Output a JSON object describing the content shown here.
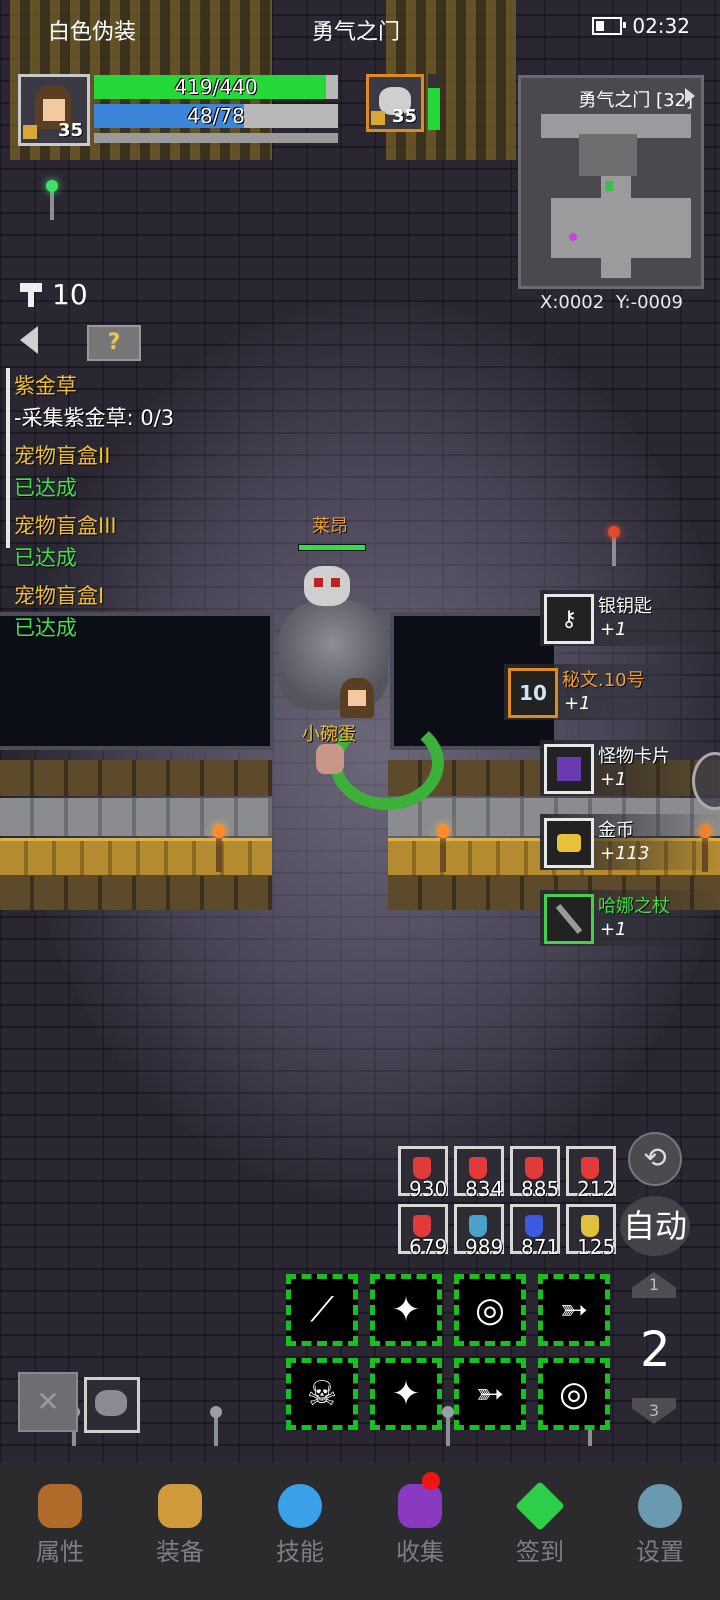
{
  "status_bar": {
    "left": "白色伪装",
    "center": "勇气之门",
    "time": "02:32"
  },
  "player": {
    "level": "35",
    "hp": "419/440",
    "hp_ratio": 0.952,
    "mp": "48/78",
    "mp_ratio": 0.615
  },
  "target": {
    "level": "35",
    "hp_ratio": 0.75
  },
  "minimap": {
    "title": "勇气之门 [32]",
    "coords": "X:0002  Y:-0009"
  },
  "resource": {
    "key_count": "10",
    "help_label": "?"
  },
  "quests": [
    {
      "title": "紫金草",
      "desc": "-采集紫金草: 0/3"
    },
    {
      "title": "宠物盲盒II",
      "desc": "已达成"
    },
    {
      "title": "宠物盲盒III",
      "desc": "已达成"
    },
    {
      "title": "宠物盲盒I",
      "desc": "已达成"
    }
  ],
  "characters": {
    "monster_name": "莱昂",
    "pet_name": "小碗蛋"
  },
  "loot": [
    {
      "name": "银钥匙",
      "count": "+1",
      "icon": "key-icon",
      "rarity": "white"
    },
    {
      "name": "秘文.10号",
      "count": "+1",
      "icon": "rune-icon",
      "rarity": "orange",
      "glyph": "10"
    },
    {
      "name": "怪物卡片",
      "count": "+1",
      "icon": "monster-card-icon",
      "rarity": "white"
    },
    {
      "name": "金币",
      "count": "+113",
      "icon": "gold-coin-icon",
      "rarity": "white"
    },
    {
      "name": "哈娜之杖",
      "count": "+1",
      "icon": "staff-icon",
      "rarity": "green"
    }
  ],
  "potions": [
    {
      "count": "930",
      "color": "#e23a3a"
    },
    {
      "count": "834",
      "color": "#e23a3a"
    },
    {
      "count": "885",
      "color": "#e23a3a"
    },
    {
      "count": "212",
      "color": "#e23a3a"
    },
    {
      "count": "679",
      "color": "#e23a3a"
    },
    {
      "count": "989",
      "color": "#4aa0c8"
    },
    {
      "count": "871",
      "color": "#3a5ae2"
    },
    {
      "count": "125",
      "color": "#e0c040"
    }
  ],
  "controls": {
    "auto_label": "自动",
    "page_up": "1",
    "page_current": "2",
    "page_down": "3"
  },
  "skills": [
    {
      "icon": "arrow-rain-icon",
      "glyph": "⟋"
    },
    {
      "icon": "bone-strike-icon",
      "glyph": "✦"
    },
    {
      "icon": "vortex-icon",
      "glyph": "◎"
    },
    {
      "icon": "gunner-icon",
      "glyph": "➳"
    },
    {
      "icon": "demon-skull-icon",
      "glyph": "☠"
    },
    {
      "icon": "bone-strike-icon",
      "glyph": "✦"
    },
    {
      "icon": "gunner-icon",
      "glyph": "➳"
    },
    {
      "icon": "vortex-icon",
      "glyph": "◎"
    }
  ],
  "nav": [
    {
      "label": "属性",
      "icon": "helmet-icon",
      "color": "#b06a2a"
    },
    {
      "label": "装备",
      "icon": "bag-icon",
      "color": "#d09a3a"
    },
    {
      "label": "技能",
      "icon": "crystal-icon",
      "color": "#3aa0e8"
    },
    {
      "label": "收集",
      "icon": "card-icon",
      "color": "#8a3ac0"
    },
    {
      "label": "签到",
      "icon": "gem-icon",
      "color": "#2ed04a"
    },
    {
      "label": "设置",
      "icon": "gear-icon",
      "color": "#6a9ab0"
    }
  ]
}
